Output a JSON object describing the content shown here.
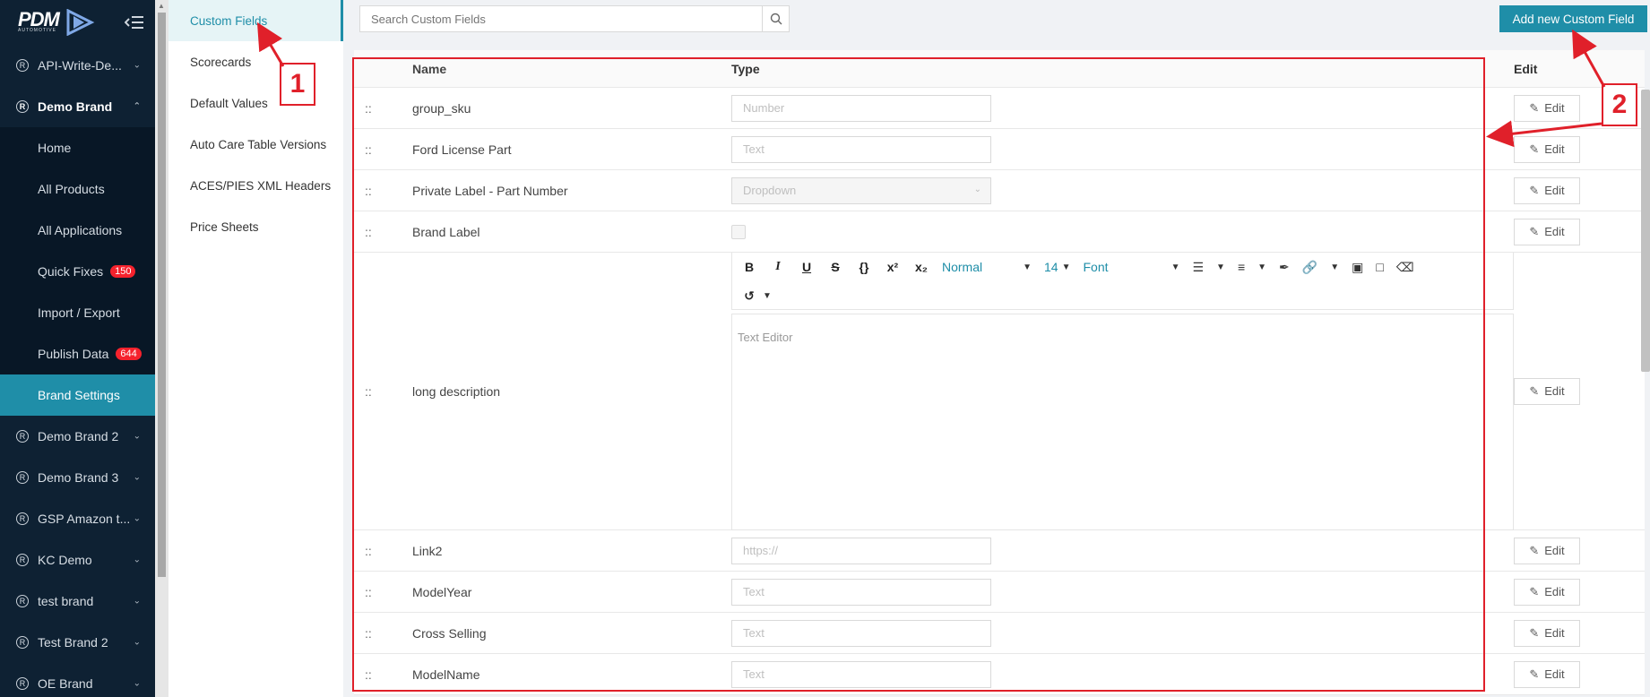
{
  "brand": {
    "logo_text": "PDM",
    "logo_sub": "AUTOMOTIVE"
  },
  "sidebar": {
    "items": [
      {
        "label": "API-Write-De...",
        "type": "brand",
        "expanded": false
      },
      {
        "label": "Demo Brand",
        "type": "brand",
        "expanded": true
      },
      {
        "label": "Home",
        "type": "sub"
      },
      {
        "label": "All Products",
        "type": "sub"
      },
      {
        "label": "All Applications",
        "type": "sub"
      },
      {
        "label": "Quick Fixes",
        "type": "sub",
        "badge": "150"
      },
      {
        "label": "Import / Export",
        "type": "sub"
      },
      {
        "label": "Publish Data",
        "type": "sub",
        "badge": "644"
      },
      {
        "label": "Brand Settings",
        "type": "sub",
        "active": true
      },
      {
        "label": "Demo Brand 2",
        "type": "brand"
      },
      {
        "label": "Demo Brand 3",
        "type": "brand"
      },
      {
        "label": "GSP Amazon t...",
        "type": "brand"
      },
      {
        "label": "KC Demo",
        "type": "brand"
      },
      {
        "label": "test brand",
        "type": "brand"
      },
      {
        "label": "Test Brand 2",
        "type": "brand"
      },
      {
        "label": "OE Brand",
        "type": "brand"
      }
    ]
  },
  "subnav": {
    "items": [
      "Custom Fields",
      "Scorecards",
      "Default Values",
      "Auto Care Table Versions",
      "ACES/PIES XML Headers",
      "Price Sheets"
    ]
  },
  "search": {
    "placeholder": "Search Custom Fields"
  },
  "add_button": "Add new Custom Field",
  "table": {
    "headers": {
      "name": "Name",
      "type": "Type",
      "edit": "Edit"
    },
    "drag_handle": "::",
    "edit_label": "Edit",
    "rows": [
      {
        "name": "group_sku",
        "type": "Number"
      },
      {
        "name": "Ford License Part",
        "type": "Text"
      },
      {
        "name": "Private Label - Part Number",
        "type": "Dropdown"
      },
      {
        "name": "Brand Label",
        "type": "checkbox"
      },
      {
        "name": "long description",
        "type": "editor"
      },
      {
        "name": "Link2",
        "type": "https://"
      },
      {
        "name": "ModelYear",
        "type": "Text"
      },
      {
        "name": "Cross Selling",
        "type": "Text"
      },
      {
        "name": "ModelName",
        "type": "Text"
      }
    ]
  },
  "editor": {
    "toolbar": {
      "bold": "B",
      "italic": "I",
      "underline": "U",
      "strike": "S",
      "code": "{}",
      "superscript": "x²",
      "subscript": "x₂",
      "heading": "Normal",
      "size": "14",
      "font": "Font"
    },
    "placeholder": "Text Editor"
  },
  "annotations": {
    "one": "1",
    "two": "2"
  },
  "colors": {
    "accent": "#1f8ea8",
    "sidebar": "#0e2133",
    "annotation": "#e0202a",
    "badge": "#f5222d"
  }
}
